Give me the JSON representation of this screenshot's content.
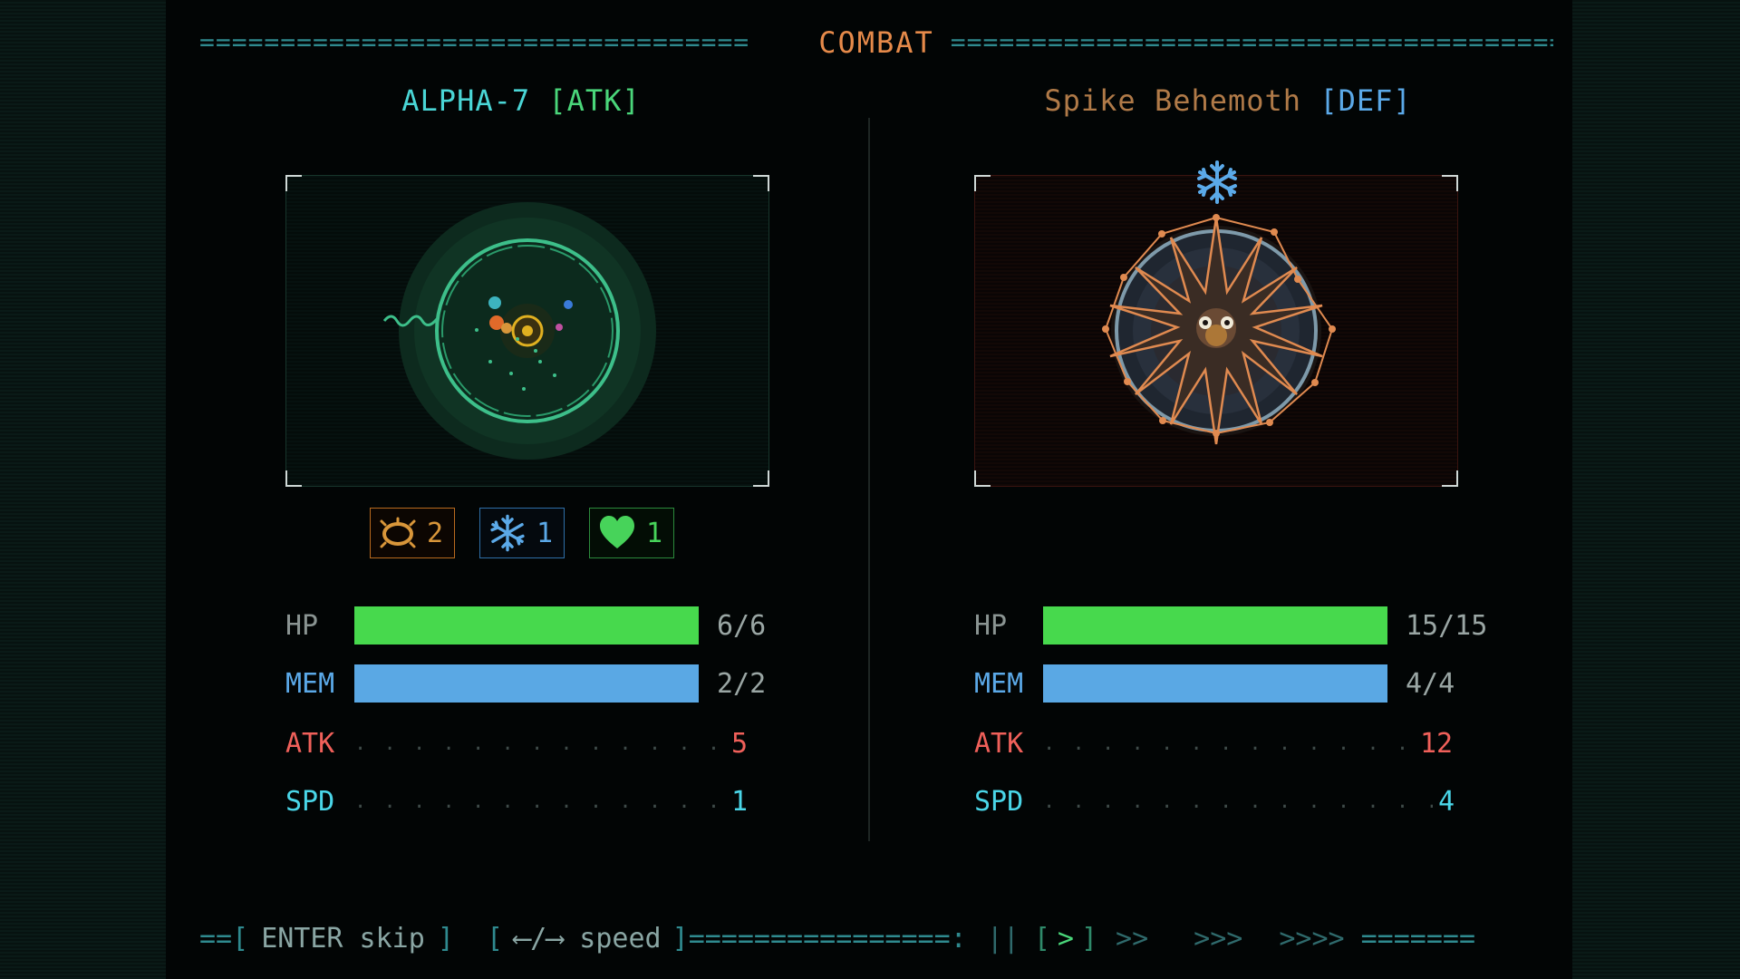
{
  "header": {
    "title": "COMBAT",
    "dash_left": "==================================",
    "dash_right": "======================================"
  },
  "player": {
    "name": "ALPHA-7",
    "role": "[ATK]",
    "buffs": [
      {
        "icon": "thorn-ring-icon",
        "count": "2",
        "color": "#d8963a"
      },
      {
        "icon": "snowflake-icon",
        "count": "1",
        "color": "#5ba9e8"
      },
      {
        "icon": "heart-icon",
        "count": "1",
        "color": "#47d35a"
      }
    ],
    "stats": {
      "hp": {
        "label": "HP",
        "text": "6/6",
        "fraction": 1.0
      },
      "mem": {
        "label": "MEM",
        "text": "2/2",
        "fraction": 1.0
      },
      "atk": {
        "label": "ATK",
        "value": "5"
      },
      "spd": {
        "label": "SPD",
        "value": "1"
      }
    }
  },
  "enemy": {
    "name": "Spike Behemoth",
    "role": "[DEF]",
    "status_icon": "snowflake-icon",
    "stats": {
      "hp": {
        "label": "HP",
        "text": "15/15",
        "fraction": 1.0
      },
      "mem": {
        "label": "MEM",
        "text": "4/4",
        "fraction": 1.0
      },
      "atk": {
        "label": "ATK",
        "value": "12"
      },
      "spd": {
        "label": "SPD",
        "value": "4"
      }
    }
  },
  "footer": {
    "left_open": "==[",
    "enter_hint": "ENTER skip",
    "close_open": "]  [",
    "arrow_hint": "⟵/⟶ speed",
    "arrow_close": "]",
    "mid_dash": "================:",
    "speeds": [
      "||",
      "[",
      ">",
      "]",
      ">>",
      ">>>",
      ">>>>"
    ],
    "end_dash": "======="
  },
  "dots": ". . . . . . . . . . . . . . . . . . . . . . . .",
  "colors": {
    "accent": "#e68a4a",
    "hp": "#47d94d",
    "mem": "#5aa8e4",
    "atk": "#f0605a",
    "spd": "#4ad6e8"
  }
}
